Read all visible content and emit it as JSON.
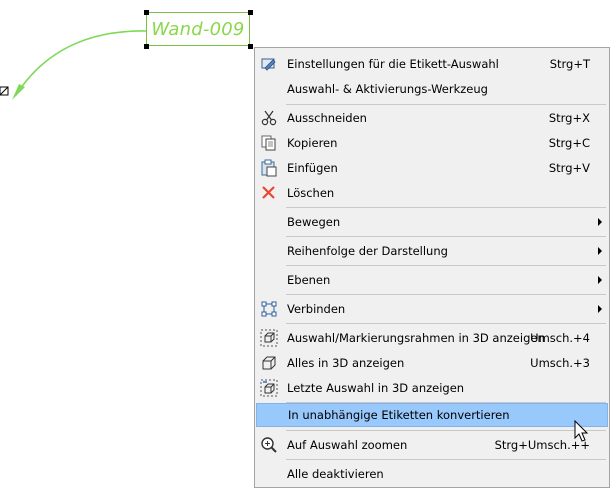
{
  "canvas": {
    "label_text": "Wand-009"
  },
  "menu": {
    "items": [
      {
        "label": "Einstellungen für die Etikett-Auswahl",
        "shortcut": "Strg+T",
        "icon": "label-settings-icon"
      },
      {
        "label": "Auswahl- & Aktivierungs-Werkzeug",
        "shortcut": "",
        "icon": ""
      },
      {
        "label": "Ausschneiden",
        "shortcut": "Strg+X",
        "icon": "scissors-icon"
      },
      {
        "label": "Kopieren",
        "shortcut": "Strg+C",
        "icon": "copy-icon"
      },
      {
        "label": "Einfügen",
        "shortcut": "Strg+V",
        "icon": "paste-icon"
      },
      {
        "label": "Löschen",
        "shortcut": "",
        "icon": "delete-icon"
      },
      {
        "label": "Bewegen",
        "shortcut": "",
        "icon": ""
      },
      {
        "label": "Reihenfolge der Darstellung",
        "shortcut": "",
        "icon": ""
      },
      {
        "label": "Ebenen",
        "shortcut": "",
        "icon": ""
      },
      {
        "label": "Verbinden",
        "shortcut": "",
        "icon": "connect-icon"
      },
      {
        "label": "Auswahl/Markierungsrahmen in 3D anzeigen",
        "shortcut": "Umsch.+4",
        "icon": "show-selection-3d-icon"
      },
      {
        "label": "Alles in 3D anzeigen",
        "shortcut": "Umsch.+3",
        "icon": "show-all-3d-icon"
      },
      {
        "label": "Letzte Auswahl in 3D anzeigen",
        "shortcut": "",
        "icon": "last-selection-3d-icon"
      },
      {
        "label": "In unabhängige Etiketten konvertieren",
        "shortcut": "",
        "icon": "",
        "highlighted": true
      },
      {
        "label": "Auf Auswahl zoomen",
        "shortcut": "Strg+Umsch.++",
        "icon": "zoom-selection-icon"
      },
      {
        "label": "Alle deaktivieren",
        "shortcut": "",
        "icon": ""
      }
    ]
  },
  "colors": {
    "label_text": "#8ad84a",
    "leader_line": "#7ed957",
    "menu_bg": "#f0f0f0",
    "highlight_bg": "#99c9fc",
    "delete_red": "#e8462f"
  }
}
